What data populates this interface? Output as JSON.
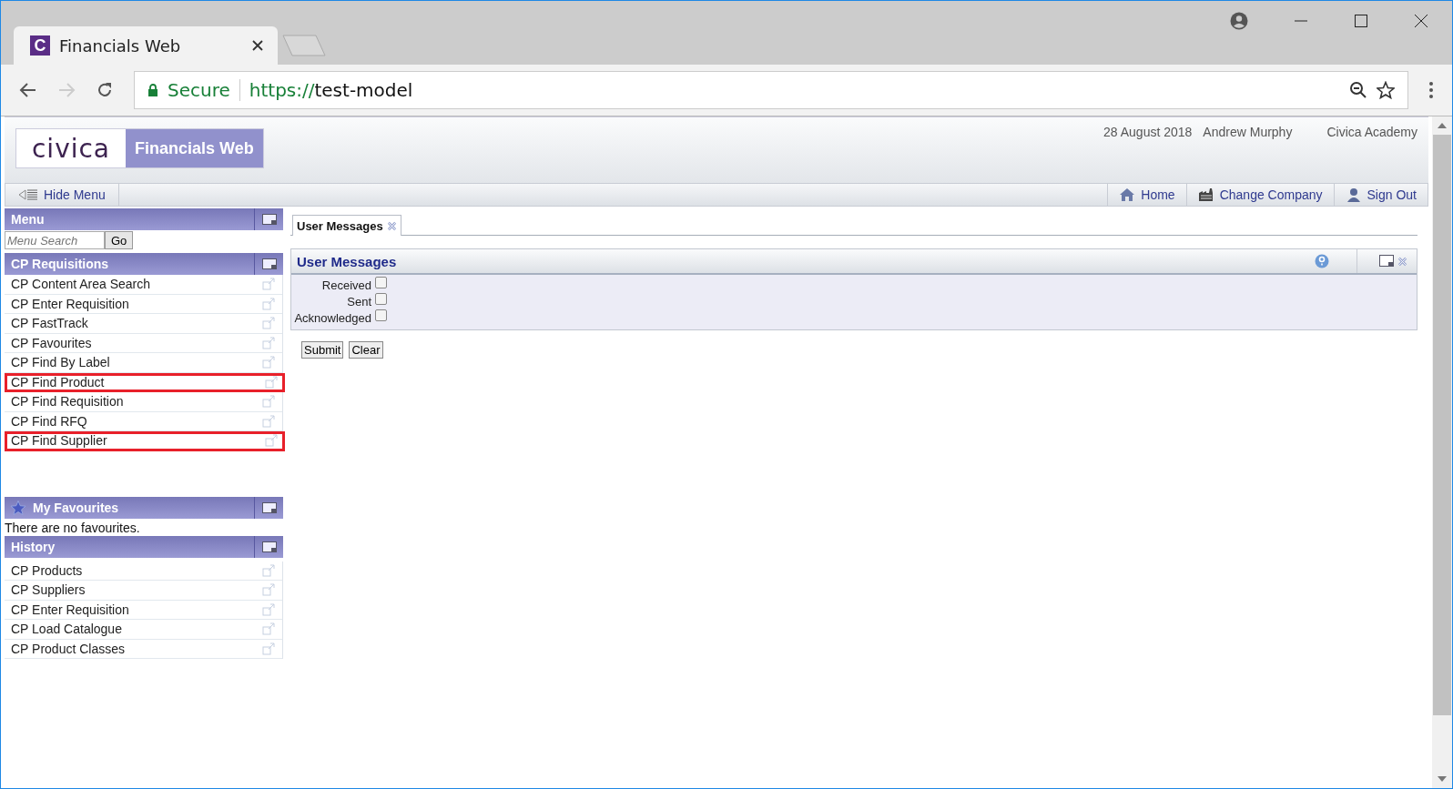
{
  "browser": {
    "tab_title": "Financials Web",
    "tab_favicon": "C",
    "url_secure": "Secure",
    "url_scheme": "https://",
    "url_host": "test-model"
  },
  "header": {
    "logo": "civica",
    "product": "Financials Web",
    "date": "28 August 2018",
    "user": "Andrew Murphy",
    "company": "Civica Academy"
  },
  "toolbar": {
    "hide_menu": "Hide Menu",
    "links": [
      {
        "kind": "home",
        "label": "Home"
      },
      {
        "kind": "company",
        "label": "Change Company"
      },
      {
        "kind": "signout",
        "label": "Sign Out"
      }
    ]
  },
  "sidebar": {
    "menu_title": "Menu",
    "search_placeholder": "Menu Search",
    "go": "Go",
    "sections": [
      {
        "kind": "list",
        "title": "CP Requisitions",
        "items": [
          {
            "label": "CP Content Area Search",
            "highlighted": false
          },
          {
            "label": "CP Enter Requisition",
            "highlighted": false
          },
          {
            "label": "CP FastTrack",
            "highlighted": false
          },
          {
            "label": "CP Favourites",
            "highlighted": false
          },
          {
            "label": "CP Find By Label",
            "highlighted": false
          },
          {
            "label": "CP Find Product",
            "highlighted": true
          },
          {
            "label": "CP Find Requisition",
            "highlighted": false
          },
          {
            "label": "CP Find RFQ",
            "highlighted": false
          },
          {
            "label": "CP Find Supplier",
            "highlighted": true
          }
        ]
      },
      {
        "kind": "favourites",
        "title": "My Favourites",
        "empty": "There are no favourites."
      },
      {
        "kind": "list",
        "title": "History",
        "items": [
          {
            "label": "CP Products",
            "highlighted": false
          },
          {
            "label": "CP Suppliers",
            "highlighted": false
          },
          {
            "label": "CP Enter Requisition",
            "highlighted": false
          },
          {
            "label": "CP Load Catalogue",
            "highlighted": false
          },
          {
            "label": "CP Product Classes",
            "highlighted": false
          }
        ]
      }
    ]
  },
  "tabs": [
    {
      "label": "User Messages",
      "selected": true
    }
  ],
  "panel": {
    "title": "User Messages",
    "filters": [
      {
        "label": "Received",
        "checked": false
      },
      {
        "label": "Sent",
        "checked": false
      },
      {
        "label": "Acknowledged",
        "checked": false
      }
    ],
    "buttons": [
      "Submit",
      "Clear"
    ]
  }
}
